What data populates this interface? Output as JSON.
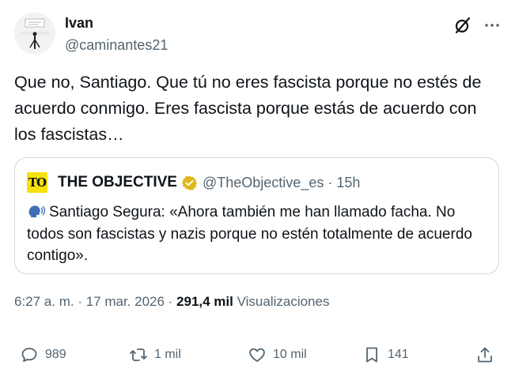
{
  "author": {
    "name": "Ivan",
    "handle": "@caminantes21"
  },
  "tweet": {
    "text": "Que no, Santiago. Que tú no eres fascista porque no estés de acuerdo conmigo. Eres fascista porque estás de acuerdo con los fascistas…"
  },
  "quote": {
    "logo_text": "TO",
    "name": "THE OBJECTIVE",
    "handle_time": "@TheObjective_es · 15h",
    "text": "Santiago Segura: «Ahora también me han llamado facha. No todos son fascistas y nazis porque no estén totalmente de acuerdo contigo».",
    "badge_color": "#e2b719"
  },
  "meta": {
    "time": "6:27 a. m. · 17 mar. 2026 · ",
    "views_count": "291,4 mil",
    "views_label": " Visualizaciones"
  },
  "actions": {
    "replies": "989",
    "reposts": "1 mil",
    "likes": "10 mil",
    "bookmarks": "141"
  },
  "icons": {
    "grok": "grok-icon",
    "more": "more-icon",
    "reply": "reply-icon",
    "repost": "repost-icon",
    "like": "heart-icon",
    "bookmark": "bookmark-icon",
    "share": "share-icon",
    "speaking": "speaking-head-icon"
  }
}
